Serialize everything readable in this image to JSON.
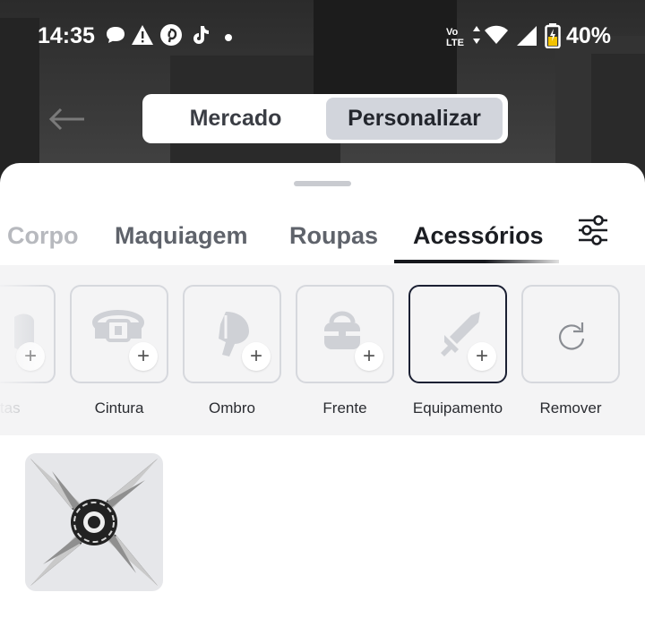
{
  "status_bar": {
    "time": "14:35",
    "battery_percent": "40%",
    "network_label_top": "Vo",
    "network_label_bottom": "LTE",
    "notification_icons": [
      "chat-bubble-icon",
      "warning-icon",
      "pinterest-icon",
      "tiktok-icon",
      "dot-icon"
    ],
    "system_icons": [
      "volte-icon",
      "wifi-icon",
      "signal-icon",
      "battery-icon"
    ]
  },
  "top": {
    "back_icon": "back-arrow-icon",
    "segments": [
      {
        "label": "Mercado",
        "selected": false
      },
      {
        "label": "Personalizar",
        "selected": true
      }
    ]
  },
  "tabs": [
    {
      "label": "Corpo",
      "active": false
    },
    {
      "label": "Maquiagem",
      "active": false
    },
    {
      "label": "Roupas",
      "active": false
    },
    {
      "label": "Acessórios",
      "active": true
    }
  ],
  "filter_icon": "sliders-icon",
  "categories": [
    {
      "label": "stas",
      "icon": "hand-icon",
      "selected": false
    },
    {
      "label": "Cintura",
      "icon": "belt-icon",
      "selected": false
    },
    {
      "label": "Ombro",
      "icon": "shoulder-icon",
      "selected": false
    },
    {
      "label": "Frente",
      "icon": "bag-icon",
      "selected": false
    },
    {
      "label": "Equipamento",
      "icon": "sword-icon",
      "selected": true
    },
    {
      "label": "Remover",
      "icon": "refresh-icon",
      "selected": false
    }
  ],
  "items": [
    {
      "icon": "shuriken-icon"
    }
  ],
  "colors": {
    "accent_dark": "#1b2033",
    "selected_segment": "#d2d5dc",
    "strip_bg": "#f4f4f5"
  }
}
